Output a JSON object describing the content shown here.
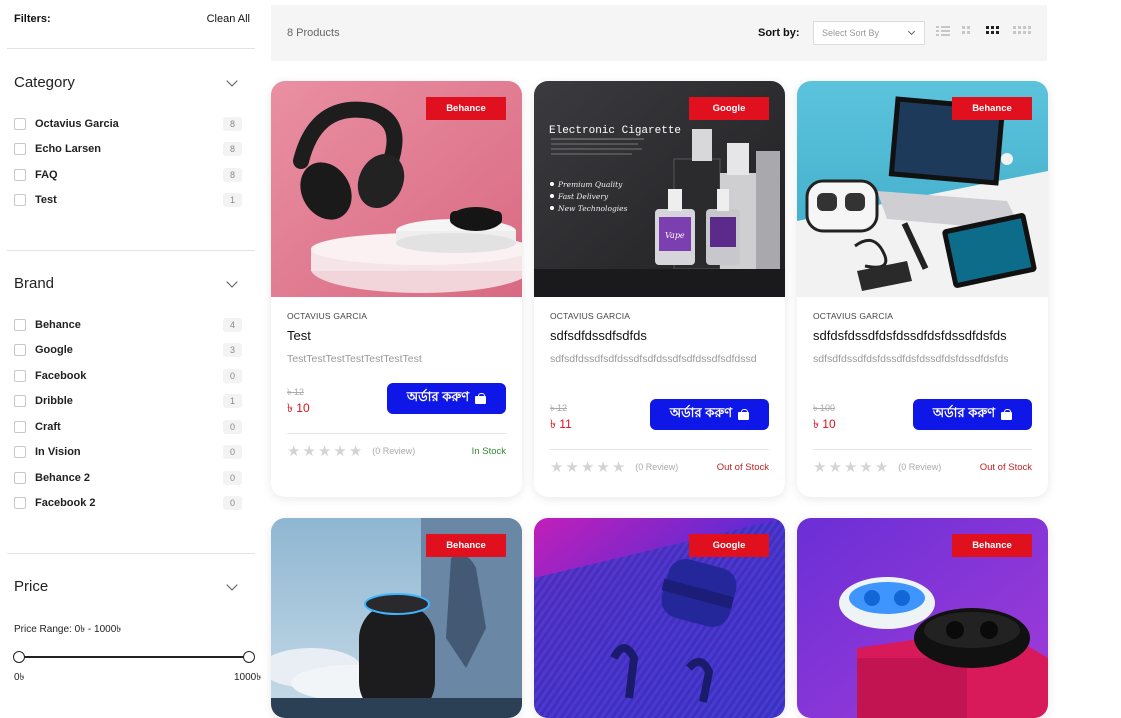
{
  "filters": {
    "title": "Filters:",
    "clean_all": "Clean All"
  },
  "category": {
    "title": "Category",
    "items": [
      {
        "label": "Octavius Garcia",
        "count": "8"
      },
      {
        "label": "Echo Larsen",
        "count": "8"
      },
      {
        "label": "FAQ",
        "count": "8"
      },
      {
        "label": "Test",
        "count": "1"
      }
    ]
  },
  "brand": {
    "title": "Brand",
    "items": [
      {
        "label": "Behance",
        "count": "4"
      },
      {
        "label": "Google",
        "count": "3"
      },
      {
        "label": "Facebook",
        "count": "0"
      },
      {
        "label": "Dribble",
        "count": "1"
      },
      {
        "label": "Craft",
        "count": "0"
      },
      {
        "label": "In Vision",
        "count": "0"
      },
      {
        "label": "Behance 2",
        "count": "0"
      },
      {
        "label": "Facebook 2",
        "count": "0"
      }
    ]
  },
  "price": {
    "title": "Price",
    "range_text": "Price Range: 0৳ - 1000৳",
    "min_label": "0৳",
    "max_label": "1000৳"
  },
  "toolbar": {
    "product_count": "8 Products",
    "sort_label": "Sort by:",
    "sort_placeholder": "Select Sort By"
  },
  "products": [
    {
      "badge": "Behance",
      "brand": "OCTAVIUS GARCIA",
      "title": "Test",
      "desc": "TestTestTestTestTestTestTest",
      "old_price": "৳ 12",
      "price": "৳ 10",
      "order_label": "অর্ডার করুণ",
      "reviews": "(0 Review)",
      "stock": "In Stock",
      "rating": 0
    },
    {
      "badge": "Google",
      "brand": "OCTAVIUS GARCIA",
      "title": "sdfsdfdssdfsdfds",
      "desc": "sdfsdfdssdfsdfdssdfsdfdssdfsdfdssdfsdfdssd",
      "old_price": "৳ 12",
      "price": "৳ 11",
      "order_label": "অর্ডার করুণ",
      "reviews": "(0 Review)",
      "stock": "Out of Stock",
      "rating": 0,
      "image_text": {
        "heading": "Electronic Cigarette",
        "bullets": [
          "Premium Quality",
          "Fast Delivery",
          "New Technologies"
        ],
        "bottle_label": "Vape"
      }
    },
    {
      "badge": "Behance",
      "brand": "OCTAVIUS GARCIA",
      "title": "sdfdsfdssdfdsfdssdfdsfdssdfdsfds",
      "desc": "sdfsdfdssdfdsfdssdfdsfdssdfdsfdssdfdsfds",
      "old_price": "৳ 100",
      "price": "৳ 10",
      "order_label": "অর্ডার করুণ",
      "reviews": "(0 Review)",
      "stock": "Out of Stock",
      "rating": 0
    },
    {
      "badge": "Behance"
    },
    {
      "badge": "Google"
    },
    {
      "badge": "Behance"
    }
  ],
  "colors": {
    "badge_red": "#e0101e",
    "order_blue": "#0f17e8",
    "price_red": "#e0101e",
    "in_stock": "#2f8a2f",
    "out_of_stock": "#c42020"
  }
}
